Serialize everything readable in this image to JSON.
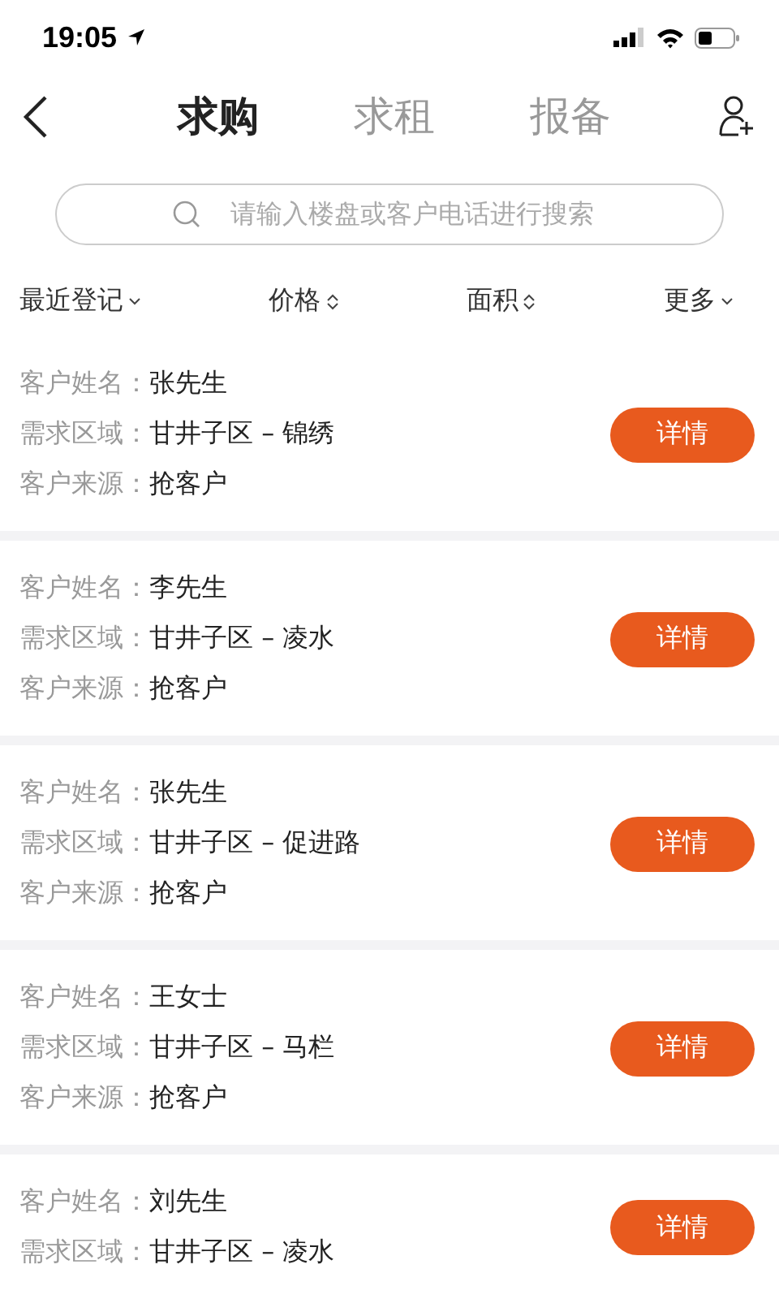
{
  "status_bar": {
    "time": "19:05"
  },
  "tabs": [
    {
      "label": "求购",
      "selected": true
    },
    {
      "label": "求租",
      "selected": false
    },
    {
      "label": "报备",
      "selected": false
    }
  ],
  "search": {
    "placeholder": "请输入楼盘或客户电话进行搜索"
  },
  "filters": [
    {
      "label": "最近登记",
      "kind": "dropdown"
    },
    {
      "label": "价格",
      "kind": "sort"
    },
    {
      "label": "面积",
      "kind": "sort"
    },
    {
      "label": "更多",
      "kind": "dropdown"
    }
  ],
  "customers": [
    {
      "fields": [
        {
          "label": "客户姓名：",
          "value": "张先生"
        },
        {
          "label": "需求区域：",
          "value": "甘井子区 – 锦绣"
        },
        {
          "label": "客户来源：",
          "value": "抢客户"
        }
      ],
      "button": "详情"
    },
    {
      "fields": [
        {
          "label": "客户姓名：",
          "value": "李先生"
        },
        {
          "label": "需求区域：",
          "value": "甘井子区 – 凌水"
        },
        {
          "label": "客户来源：",
          "value": "抢客户"
        }
      ],
      "button": "详情"
    },
    {
      "fields": [
        {
          "label": "客户姓名：",
          "value": "张先生"
        },
        {
          "label": "需求区域：",
          "value": "甘井子区 – 促进路"
        },
        {
          "label": "客户来源：",
          "value": "抢客户"
        }
      ],
      "button": "详情"
    },
    {
      "fields": [
        {
          "label": "客户姓名：",
          "value": "王女士"
        },
        {
          "label": "需求区域：",
          "value": "甘井子区 – 马栏"
        },
        {
          "label": "客户来源：",
          "value": "抢客户"
        }
      ],
      "button": "详情"
    },
    {
      "fields": [
        {
          "label": "客户姓名：",
          "value": "刘先生"
        },
        {
          "label": "需求区域：",
          "value": "甘井子区 – 凌水"
        }
      ],
      "button": "详情"
    }
  ]
}
